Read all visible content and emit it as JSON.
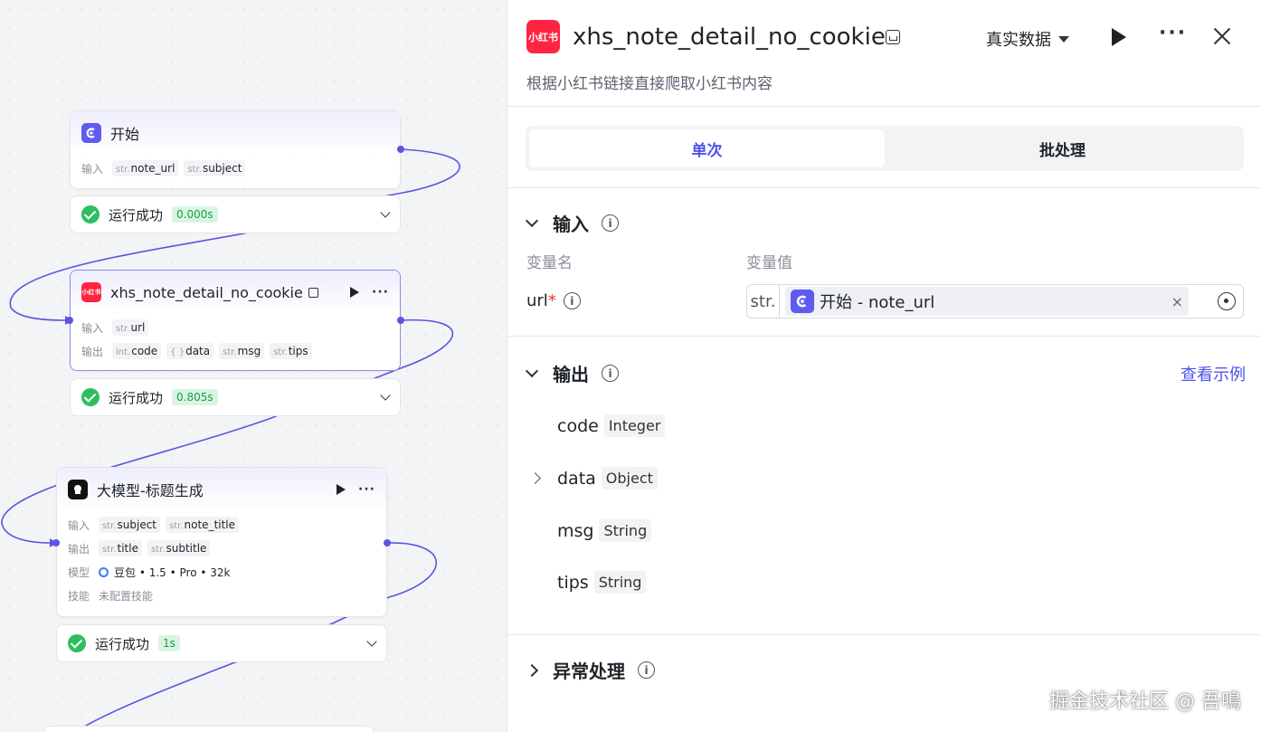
{
  "canvas": {
    "nodes": [
      {
        "title": "开始",
        "input_label": "输入",
        "inputs": [
          {
            "type": "str.",
            "name": "note_url"
          },
          {
            "type": "str.",
            "name": "subject"
          }
        ],
        "status": "运行成功",
        "time": "0.000s"
      },
      {
        "title": "xhs_note_detail_no_cookie",
        "icon_text": "小红书",
        "input_label": "输入",
        "inputs": [
          {
            "type": "str.",
            "name": "url"
          }
        ],
        "output_label": "输出",
        "outputs": [
          {
            "type": "int.",
            "name": "code"
          },
          {
            "type": "{ }",
            "name": "data"
          },
          {
            "type": "str.",
            "name": "msg"
          },
          {
            "type": "str.",
            "name": "tips"
          }
        ],
        "status": "运行成功",
        "time": "0.805s"
      },
      {
        "title": "大模型-标题生成",
        "input_label": "输入",
        "inputs": [
          {
            "type": "str.",
            "name": "subject"
          },
          {
            "type": "str.",
            "name": "note_title"
          }
        ],
        "output_label": "输出",
        "outputs": [
          {
            "type": "str.",
            "name": "title"
          },
          {
            "type": "str.",
            "name": "subtitle"
          }
        ],
        "model_label": "模型",
        "model": "豆包 • 1.5 • Pro • 32k",
        "skill_label": "技能",
        "skill": "未配置技能",
        "status": "运行成功",
        "time": "1s"
      }
    ]
  },
  "panel": {
    "logo_text": "小红书",
    "title": "xhs_note_detail_no_cookie",
    "data_select": "真实数据",
    "description": "根据小红书链接直接爬取小红书内容",
    "tabs": [
      "单次",
      "批处理"
    ],
    "input_section": {
      "title": "输入",
      "col_name": "变量名",
      "col_value": "变量值",
      "var_name": "url",
      "required_mark": "*",
      "value_type": "str.",
      "value_ref": "开始 - note_url",
      "clear": "×"
    },
    "output_section": {
      "title": "输出",
      "see_example": "查看示例",
      "fields": [
        {
          "name": "code",
          "type": "Integer"
        },
        {
          "name": "data",
          "type": "Object"
        },
        {
          "name": "msg",
          "type": "String"
        },
        {
          "name": "tips",
          "type": "String"
        }
      ]
    },
    "error_section": {
      "title": "异常处理"
    },
    "info_glyph": "i"
  },
  "watermark": "掘金技术社区 @ 吾鳴",
  "colors": {
    "accent": "#4d53e8",
    "success": "#2dbe60",
    "brand_red": "#ff2442",
    "edge": "#5b55e0"
  }
}
